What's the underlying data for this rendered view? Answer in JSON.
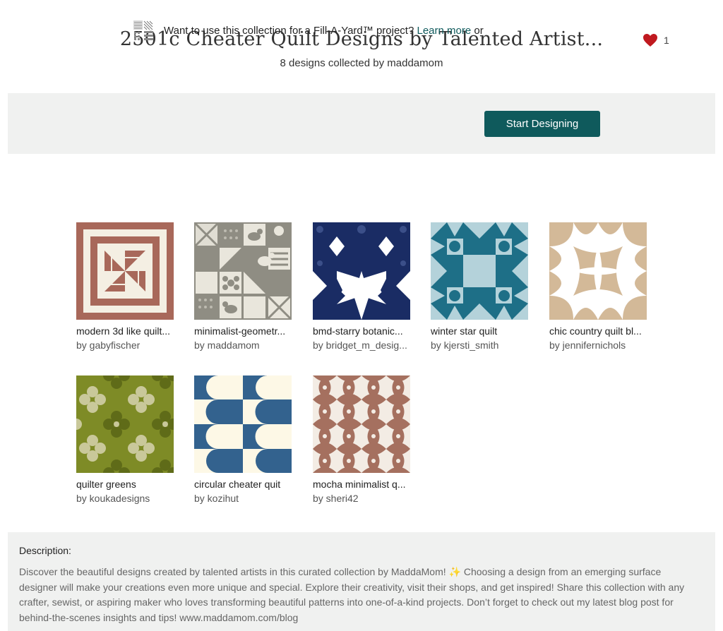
{
  "header": {
    "title": "2501c Cheater Quilt Designs by Talented Artist...",
    "subtitle": "8 designs collected by maddamom",
    "like_count": "1"
  },
  "banner": {
    "icon": "fabric-swatch-icon",
    "text": "Want to use this collection for a Fill-A-Yard™ project?",
    "link_text": "Learn more",
    "or_text": "or",
    "button_label": "Start Designing"
  },
  "designs": [
    {
      "name": "modern 3d like quilt...",
      "by": "by gabyfischer"
    },
    {
      "name": "minimalist-geometr...",
      "by": "by maddamom"
    },
    {
      "name": "bmd-starry botanic...",
      "by": "by bridget_m_desig..."
    },
    {
      "name": "winter star quilt",
      "by": "by kjersti_smith"
    },
    {
      "name": "chic country quilt bl...",
      "by": "by jennifernichols"
    },
    {
      "name": "quilter greens",
      "by": "by koukadesigns"
    },
    {
      "name": "circular cheater quit",
      "by": "by kozihut"
    },
    {
      "name": "mocha minimalist q...",
      "by": "by sheri42"
    }
  ],
  "description": {
    "label": "Description:",
    "text": "Discover the beautiful designs created by talented artists in this curated collection by MaddaMom! ✨ Choosing a design from an emerging surface designer will make your creations even more unique and special. Explore their creativity, visit their shops, and get inspired! Share this collection with any crafter, sewist, or aspiring maker who loves transforming beautiful patterns into one-of-a-kind projects. Don’t forget to check out my latest blog post for behind-the-scenes insights and tips! www.maddamom.com/blog"
  },
  "colors": {
    "accent": "#0f5a5c",
    "heart": "#c0191f",
    "panel": "#f0f1f0"
  }
}
